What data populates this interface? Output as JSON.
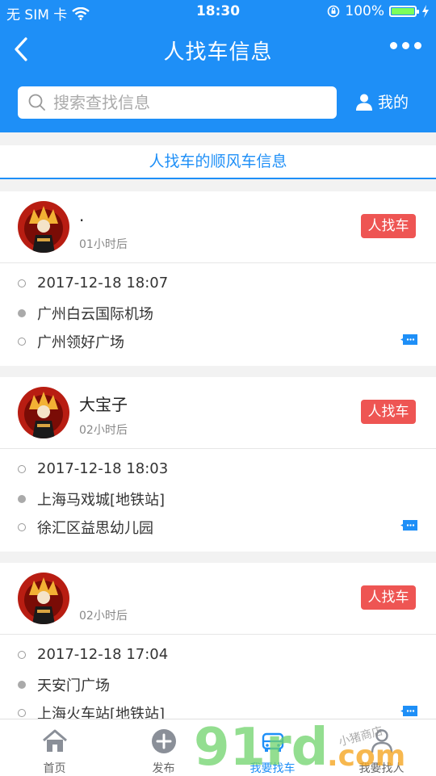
{
  "status_bar": {
    "carrier": "无 SIM 卡",
    "time": "18:30",
    "battery": "100%"
  },
  "nav": {
    "title": "人找车信息"
  },
  "search": {
    "placeholder": "搜索查找信息",
    "mine_label": "我的"
  },
  "section": {
    "title": "人找车的顺风车信息"
  },
  "cards": [
    {
      "name": ".",
      "time_relative": "01小时后",
      "tag": "人找车",
      "datetime": "2017-12-18 18:07",
      "from": "广州白云国际机场",
      "to": "广州领好广场"
    },
    {
      "name": "大宝子",
      "time_relative": "02小时后",
      "tag": "人找车",
      "datetime": "2017-12-18 18:03",
      "from": "上海马戏城[地铁站]",
      "to": "徐汇区益思幼儿园"
    },
    {
      "name": "",
      "time_relative": "02小时后",
      "tag": "人找车",
      "datetime": "2017-12-18 17:04",
      "from": "天安门广场",
      "to": "上海火车站[地铁站]"
    }
  ],
  "tabbar": {
    "items": [
      {
        "label": "首页",
        "icon": "home-icon"
      },
      {
        "label": "发布",
        "icon": "plus-icon"
      },
      {
        "label": "我要找车",
        "icon": "car-icon"
      },
      {
        "label": "我要找人",
        "icon": "person-icon"
      }
    ]
  },
  "watermark": {
    "brand": "91rd",
    "suffix": ".com",
    "slogan": "小猪商店"
  },
  "colors": {
    "primary": "#1e8ff7",
    "tag": "#ee5553",
    "active_tab": "#1e8ff7"
  }
}
